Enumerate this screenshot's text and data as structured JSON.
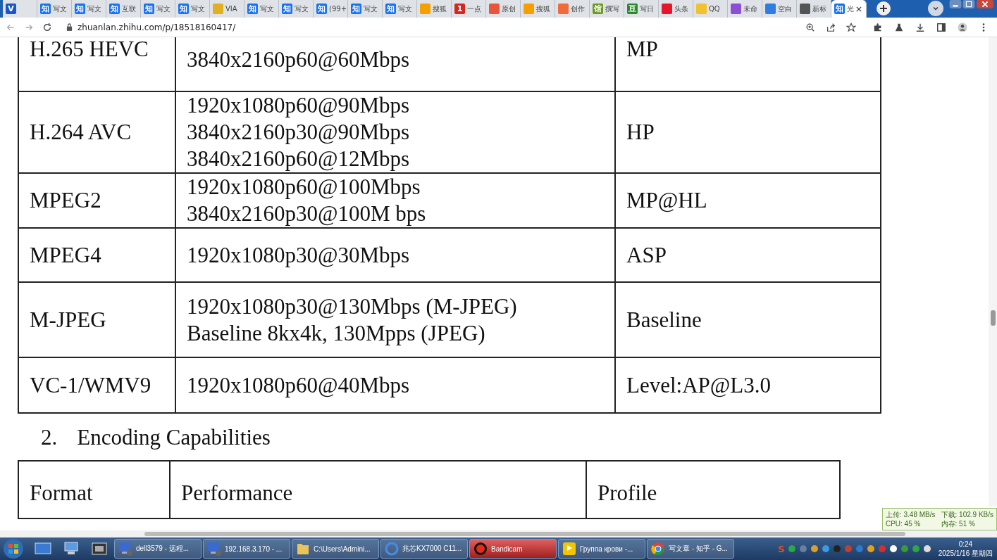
{
  "tabs": [
    {
      "icon_text": "V",
      "color": "#1a56c8",
      "selected": false
    },
    {
      "label": "写文",
      "icon_text": "知",
      "color": "#1772f6",
      "selected": false
    },
    {
      "label": "写文",
      "icon_text": "知",
      "color": "#1772f6",
      "selected": false
    },
    {
      "label": "互联",
      "icon_text": "知",
      "color": "#1772f6",
      "selected": false
    },
    {
      "label": "写文",
      "icon_text": "知",
      "color": "#1772f6",
      "selected": false
    },
    {
      "label": "写文",
      "icon_text": "知",
      "color": "#1772f6",
      "selected": false
    },
    {
      "label": "VIA",
      "color": "#e0b020",
      "selected": false
    },
    {
      "label": "写文",
      "icon_text": "知",
      "color": "#1772f6",
      "selected": false
    },
    {
      "label": "写文",
      "icon_text": "知",
      "color": "#1772f6",
      "selected": false
    },
    {
      "label": "(99+",
      "icon_text": "知",
      "color": "#1772f6",
      "selected": false
    },
    {
      "label": "写文",
      "icon_text": "知",
      "color": "#1772f6",
      "selected": false
    },
    {
      "label": "写文",
      "icon_text": "知",
      "color": "#1772f6",
      "selected": false
    },
    {
      "label": "搜狐",
      "color": "#f5a000",
      "selected": false
    },
    {
      "label": "一点",
      "icon_text": "1",
      "color": "#d9261c",
      "selected": false
    },
    {
      "label": "原创",
      "color": "#e8553b",
      "selected": false
    },
    {
      "label": "搜狐",
      "color": "#f5a000",
      "selected": false
    },
    {
      "label": "创作",
      "color": "#f06a3a",
      "selected": false
    },
    {
      "label": "撰写",
      "icon_text": "馆",
      "color": "#6a9a1f",
      "selected": false
    },
    {
      "label": "写日",
      "icon_text": "豆",
      "color": "#2a8a2a",
      "selected": false
    },
    {
      "label": "头条",
      "color": "#e6162d",
      "selected": false
    },
    {
      "label": "QQ",
      "color": "#f2c12e",
      "selected": false
    },
    {
      "label": "未命",
      "color": "#8b4fd6",
      "selected": false
    },
    {
      "label": "空白",
      "color": "#2f7de1",
      "selected": false
    },
    {
      "label": "新标",
      "color": "#555555",
      "selected": false
    },
    {
      "label": "光",
      "icon_text": "知",
      "color": "#1772f6",
      "selected": true
    }
  ],
  "address": "zhuanlan.zhihu.com/p/18518160417/",
  "table1": {
    "rows": [
      {
        "format": "H.265 HEVC",
        "performance": [
          "3840x2160p60@60Mbps"
        ],
        "profile": "MP"
      },
      {
        "format": "H.264 AVC",
        "performance": [
          "1920x1080p60@90Mbps",
          "3840x2160p30@90Mbps",
          "3840x2160p60@12Mbps"
        ],
        "profile": "HP"
      },
      {
        "format": "MPEG2",
        "performance": [
          "1920x1080p60@100Mbps",
          "3840x2160p30@100M bps"
        ],
        "profile": "MP@HL"
      },
      {
        "format": "MPEG4",
        "performance": [
          "1920x1080p30@30Mbps"
        ],
        "profile": "ASP"
      },
      {
        "format": "M-JPEG",
        "performance": [
          "1920x1080p30@130Mbps (M-JPEG)",
          "Baseline 8kx4k, 130Mpps (JPEG)"
        ],
        "profile": "Baseline"
      },
      {
        "format": "VC-1/WMV9",
        "performance": [
          "1920x1080p60@40Mbps"
        ],
        "profile": "Level:AP@L3.0"
      }
    ]
  },
  "heading": {
    "number": "2.",
    "text": "Encoding Capabilities"
  },
  "table2": {
    "columns": [
      "Format",
      "Performance",
      "Profile"
    ]
  },
  "net_monitor": {
    "upload": "上传: 3.48 MB/s",
    "download": "下载: 102.9 KB/s",
    "cpu": "CPU: 45 %",
    "memory": "内存: 51 %"
  },
  "taskbar": {
    "items": [
      {
        "label": "dell3579 - 远程...",
        "kind": "remote",
        "selected": false
      },
      {
        "label": "192.168.3.170 - ...",
        "kind": "remote",
        "selected": false
      },
      {
        "label": "C:\\Users\\Admini...",
        "kind": "folder",
        "selected": false
      },
      {
        "label": "兆芯KX7000 C11...",
        "kind": "circle",
        "selected": false
      },
      {
        "label": "Bandicam",
        "kind": "record",
        "selected": true
      },
      {
        "label": "Группа крови -...",
        "kind": "player",
        "selected": false
      },
      {
        "label": "写文章 - 知乎 - G...",
        "kind": "chrome",
        "selected": false
      }
    ],
    "tray_badge": "S",
    "time": "0:24",
    "date": "2025/1/16 星期四"
  }
}
